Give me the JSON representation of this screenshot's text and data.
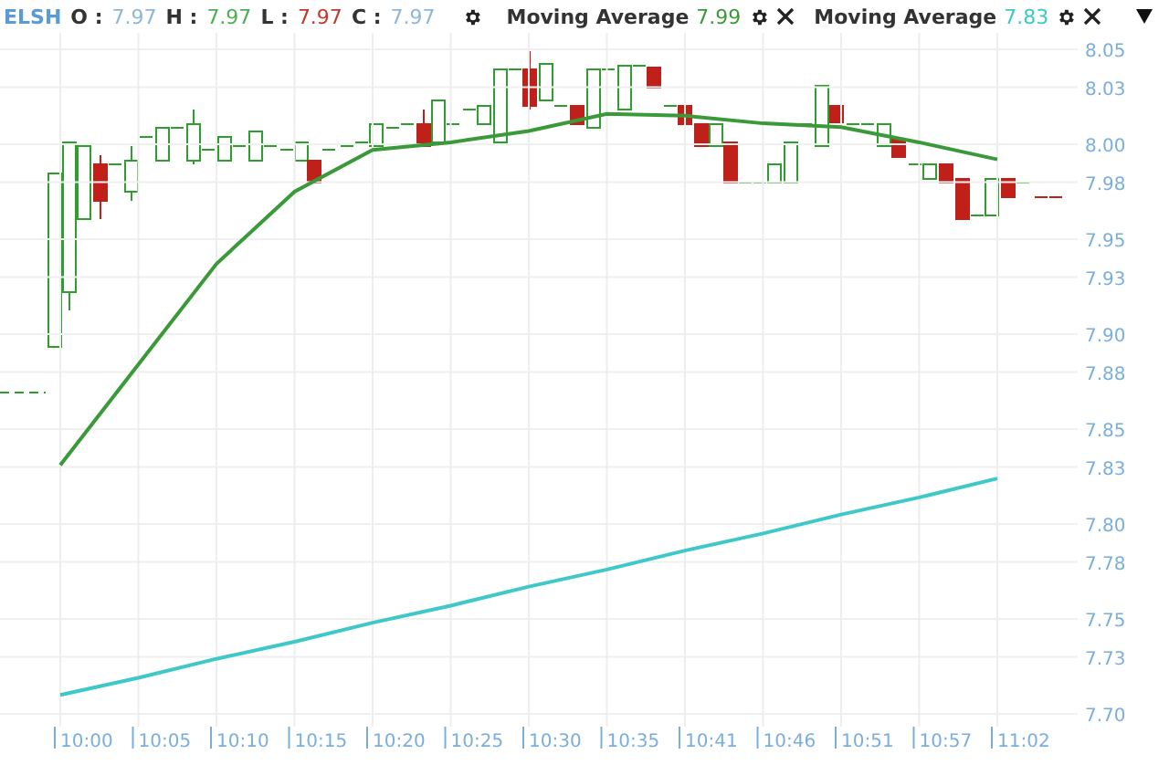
{
  "legend": {
    "symbol": "ELSH",
    "ohlc": [
      {
        "label": "O :",
        "value": "7.97",
        "color": "#8db6dc"
      },
      {
        "label": "H :",
        "value": "7.97",
        "color": "#4caf50"
      },
      {
        "label": "L :",
        "value": "7.97",
        "color": "#c0392b"
      },
      {
        "label": "C :",
        "value": "7.97",
        "color": "#8db6dc"
      }
    ]
  },
  "indicators": [
    {
      "value": "7.99"
    },
    {
      "value": "7.83"
    }
  ],
  "chart": {
    "chart_data": {
      "type": "line",
      "grid": true,
      "x": [
        "10:00",
        "10:05",
        "10:10",
        "10:15",
        "10:20",
        "10:25",
        "10:30",
        "10:35",
        "10:41",
        "10:46",
        "10:51",
        "10:57",
        "11:02"
      ],
      "ylim": [
        7.7,
        8.05
      ],
      "yticks": [
        {
          "value": 8.05,
          "label": "8.05"
        },
        {
          "value": 8.03,
          "label": "8.03"
        },
        {
          "value": 8.0,
          "label": "8.00"
        },
        {
          "value": 7.98,
          "label": "7.98"
        },
        {
          "value": 7.95,
          "label": "7.95"
        },
        {
          "value": 7.93,
          "label": "7.93"
        },
        {
          "value": 7.9,
          "label": "7.90"
        },
        {
          "value": 7.88,
          "label": "7.88"
        },
        {
          "value": 7.85,
          "label": "7.85"
        },
        {
          "value": 7.83,
          "label": "7.83"
        },
        {
          "value": 7.8,
          "label": "7.80"
        },
        {
          "value": 7.78,
          "label": "7.78"
        },
        {
          "value": 7.75,
          "label": "7.75"
        },
        {
          "value": 7.73,
          "label": "7.73"
        },
        {
          "value": 7.7,
          "label": "7.70"
        }
      ],
      "series": [
        {
          "name": "Moving Average",
          "color": "#3a9a3a",
          "values": [
            7.831,
            7.884,
            7.937,
            7.975,
            7.997,
            8.001,
            8.007,
            8.016,
            8.015,
            8.011,
            8.009,
            8.001,
            7.992
          ]
        },
        {
          "name": "Moving Average",
          "color": "#3ec8c8",
          "values": [
            7.71,
            7.719,
            7.729,
            7.738,
            7.748,
            7.757,
            7.767,
            7.776,
            7.786,
            7.795,
            7.805,
            7.814,
            7.824
          ]
        }
      ]
    }
  }
}
